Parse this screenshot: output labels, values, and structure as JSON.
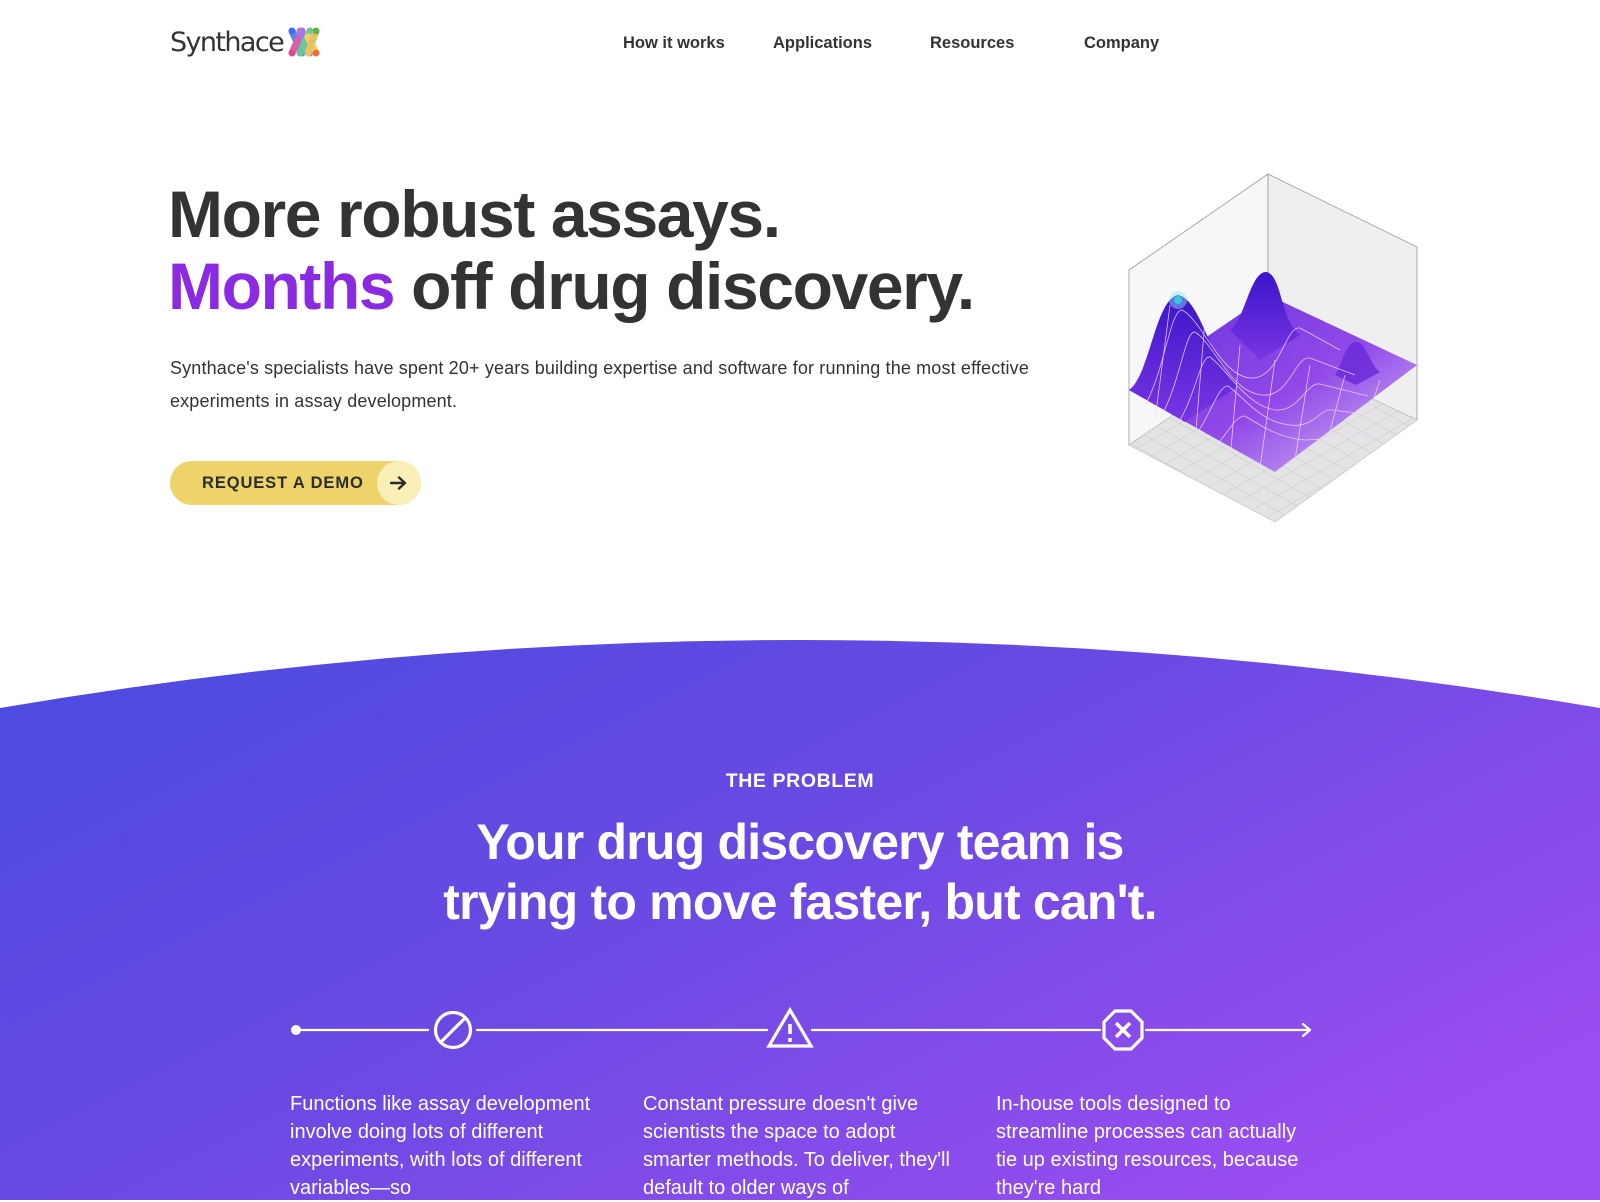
{
  "brand": {
    "name": "Synthace",
    "logo_icon": "multicolor-x-logo-icon",
    "accent_color": "#8a2be2",
    "cta_color": "#edd36a"
  },
  "nav": {
    "items": [
      {
        "label": "How it works"
      },
      {
        "label": "Applications"
      },
      {
        "label": "Resources"
      },
      {
        "label": "Company"
      }
    ]
  },
  "hero": {
    "title_line1": "More robust assays.",
    "title_line2_accent": "Months",
    "title_line2_rest": " off drug discovery.",
    "subtitle": "Synthace's specialists have spent 20+ years building expertise and software for running the most effective experiments in assay development.",
    "cta_label": "REQUEST A DEMO",
    "cta_icon": "arrow-right-icon",
    "illustration": "3d-surface-plot-illustration"
  },
  "problem": {
    "eyebrow": "THE PROBLEM",
    "title_line1": "Your drug discovery team is",
    "title_line2": "trying to move faster, but can't.",
    "gradient": {
      "start": "#4a4bdf",
      "end": "#9a4df0"
    },
    "timeline_icons": [
      "prohibited-icon",
      "warning-triangle-icon",
      "stop-x-octagon-icon"
    ],
    "columns": [
      {
        "text": "Functions like assay development involve doing lots of different experiments, with lots of different variables—so"
      },
      {
        "text": "Constant pressure doesn't give scientists the space to adopt smarter methods. To deliver, they'll default to older ways of"
      },
      {
        "text": "In-house tools designed to streamline processes can actually tie up existing resources, because they're hard"
      }
    ]
  }
}
